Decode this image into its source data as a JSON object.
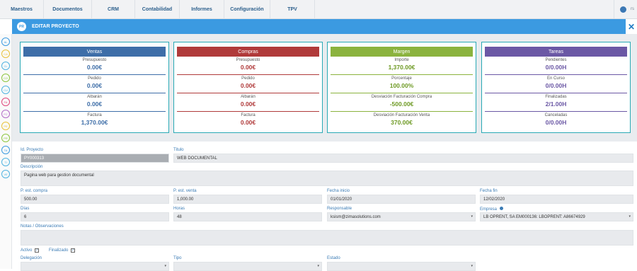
{
  "nav": {
    "items": [
      {
        "label": "Maestros",
        "w": 62
      },
      {
        "label": "Documentos",
        "w": 68
      },
      {
        "label": "CRM",
        "w": 61
      },
      {
        "label": "Contabilidad",
        "w": 63
      },
      {
        "label": "Informes",
        "w": 63
      },
      {
        "label": "Configuración",
        "w": 65
      },
      {
        "label": "TPV",
        "w": 63
      }
    ],
    "user_text": "rs"
  },
  "sidebar": {
    "icons": [
      {
        "name": "al-icon",
        "text": "AL",
        "color": "#3b9ae1"
      },
      {
        "name": "ca-icon",
        "text": "CA",
        "color": "#e8c23a"
      },
      {
        "name": "cl-icon",
        "text": "CL",
        "color": "#4fb3e0"
      },
      {
        "name": "co-icon",
        "text": "CO",
        "color": "#8dc63f"
      },
      {
        "name": "cu-icon",
        "text": "CU",
        "color": "#4fb3e0"
      },
      {
        "name": "fa-icon",
        "text": "FA",
        "color": "#e0457b"
      },
      {
        "name": "fc-icon",
        "text": "FC",
        "color": "#b36bc8"
      },
      {
        "name": "pe-icon",
        "text": "PE",
        "color": "#e8c23a"
      },
      {
        "name": "pr-icon",
        "text": "PR",
        "color": "#8dc63f"
      },
      {
        "name": "ta-icon",
        "text": "TA",
        "color": "#3b9ae1"
      },
      {
        "name": "ti-icon",
        "text": "TI",
        "color": "#4fb3e0"
      },
      {
        "name": "ve-icon",
        "text": "VE",
        "color": "#4fb3e0"
      }
    ]
  },
  "header": {
    "badge": "PR",
    "title": "EDITAR PROYECTO",
    "close": "✕"
  },
  "cards": [
    {
      "key": "ventas",
      "title": "Ventas",
      "color": "#3e6ea8",
      "border": "#2aa9b5",
      "value_color": "#3e6ea8",
      "metrics": [
        {
          "label": "Presupuesto",
          "value": "0.00€"
        },
        {
          "label": "Pedido",
          "value": "0.00€"
        },
        {
          "label": "Albarán",
          "value": "0.00€"
        },
        {
          "label": "Factura",
          "value": "1,370.00€"
        }
      ]
    },
    {
      "key": "compras",
      "title": "Compras",
      "color": "#b03a3a",
      "border": "#2aa9b5",
      "value_color": "#b03a3a",
      "metrics": [
        {
          "label": "Presupuesto",
          "value": "0.00€"
        },
        {
          "label": "Pedido",
          "value": "0.00€"
        },
        {
          "label": "Albarán",
          "value": "0.00€"
        },
        {
          "label": "Factura",
          "value": "0.00€"
        }
      ]
    },
    {
      "key": "margen",
      "title": "Margen",
      "color": "#8bb33e",
      "border": "#2aa9b5",
      "value_color": "#6e9a24",
      "metrics": [
        {
          "label": "Importe",
          "value": "1,370.00€"
        },
        {
          "label": "Porcentaje",
          "value": "100.00%"
        },
        {
          "label": "Desviación Facturación Compra",
          "value": "-500.00€"
        },
        {
          "label": "Desviación Facturación Venta",
          "value": "370.00€"
        }
      ]
    },
    {
      "key": "tareas",
      "title": "Tareas",
      "color": "#6b58a5",
      "border": "#2aa9b5",
      "value_color": "#6b58a5",
      "metrics": [
        {
          "label": "Pendientes",
          "value": "0/0.00H"
        },
        {
          "label": "En Curso",
          "value": "0/0.00H"
        },
        {
          "label": "Finalizadas",
          "value": "2/1.00H"
        },
        {
          "label": "Canceladas",
          "value": "0/0.00H"
        }
      ]
    }
  ],
  "form": {
    "id_label": "Id. Proyecto",
    "id_value": "PY000313",
    "titulo_label": "Titulo",
    "titulo_value": "WEB DOCUMENTAL",
    "desc_label": "Descripción",
    "desc_value": "Pagina web para gestion documental",
    "pcompra_label": "P. est. compra",
    "pcompra_value": "500.00",
    "pventa_label": "P. est. venta",
    "pventa_value": "1,000.00",
    "finicio_label": "Fecha inicio",
    "finicio_value": "01/01/2020",
    "ffin_label": "Fecha fin",
    "ffin_value": "12/02/2020",
    "dias_label": "Días",
    "dias_value": "6",
    "horas_label": "Horas",
    "horas_value": "48",
    "resp_label": "Responsable",
    "resp_value": "ksism@zimasolutions.com",
    "empresa_label": "Empresa",
    "empresa_value": "LB OPRENT, SA EM000136: LBOPRENT: A86674929",
    "notas_label": "Notas / Observaciones",
    "notas_value": "",
    "activo_label": "Activo",
    "finalizado_label": "Finalizado",
    "delegacion_label": "Delegación",
    "tipo_label": "Tipo",
    "estado_label": "Estado",
    "check": "✓",
    "caret": "▾"
  }
}
